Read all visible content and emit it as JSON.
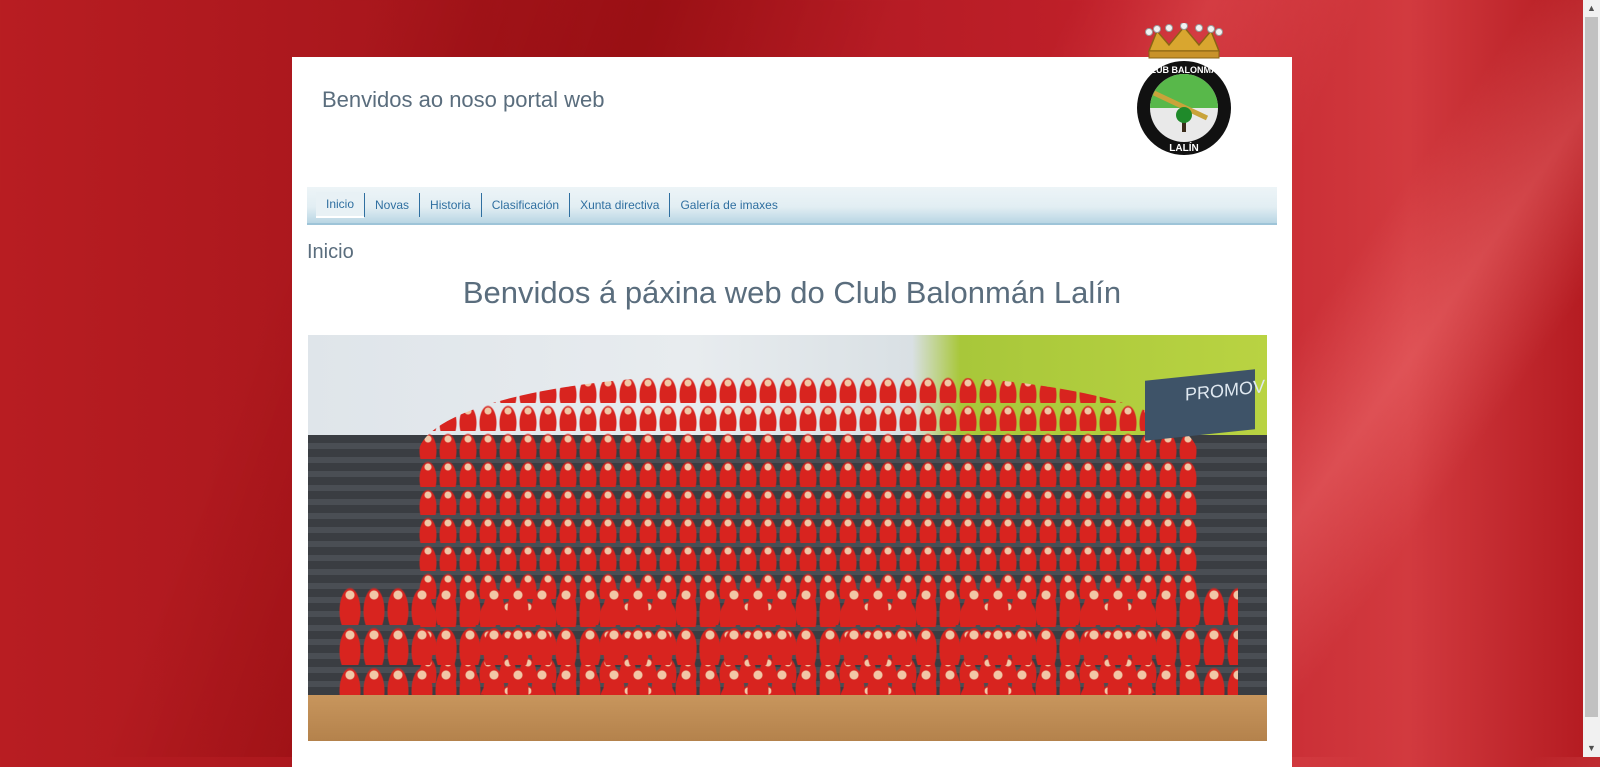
{
  "header": {
    "site_title": "Benvidos ao noso portal web",
    "logo": {
      "top_text": "CLUB BALONMÁN",
      "bottom_text": "LALÍN",
      "icon": "club-crest-crown-tree"
    }
  },
  "nav": {
    "items": [
      {
        "label": "Inicio",
        "active": true
      },
      {
        "label": "Novas"
      },
      {
        "label": "Historia"
      },
      {
        "label": "Clasificación"
      },
      {
        "label": "Xunta directiva"
      },
      {
        "label": "Galería de imaxes"
      }
    ]
  },
  "main": {
    "page_heading": "Inicio",
    "headline": "Benvidos á páxina web do Club Balonmán Lalín",
    "photo": {
      "banner_text": "PROMOV"
    }
  },
  "colors": {
    "background_red": "#b81d22",
    "text_slate": "#5a6d7d",
    "nav_link": "#2f6fa0"
  }
}
